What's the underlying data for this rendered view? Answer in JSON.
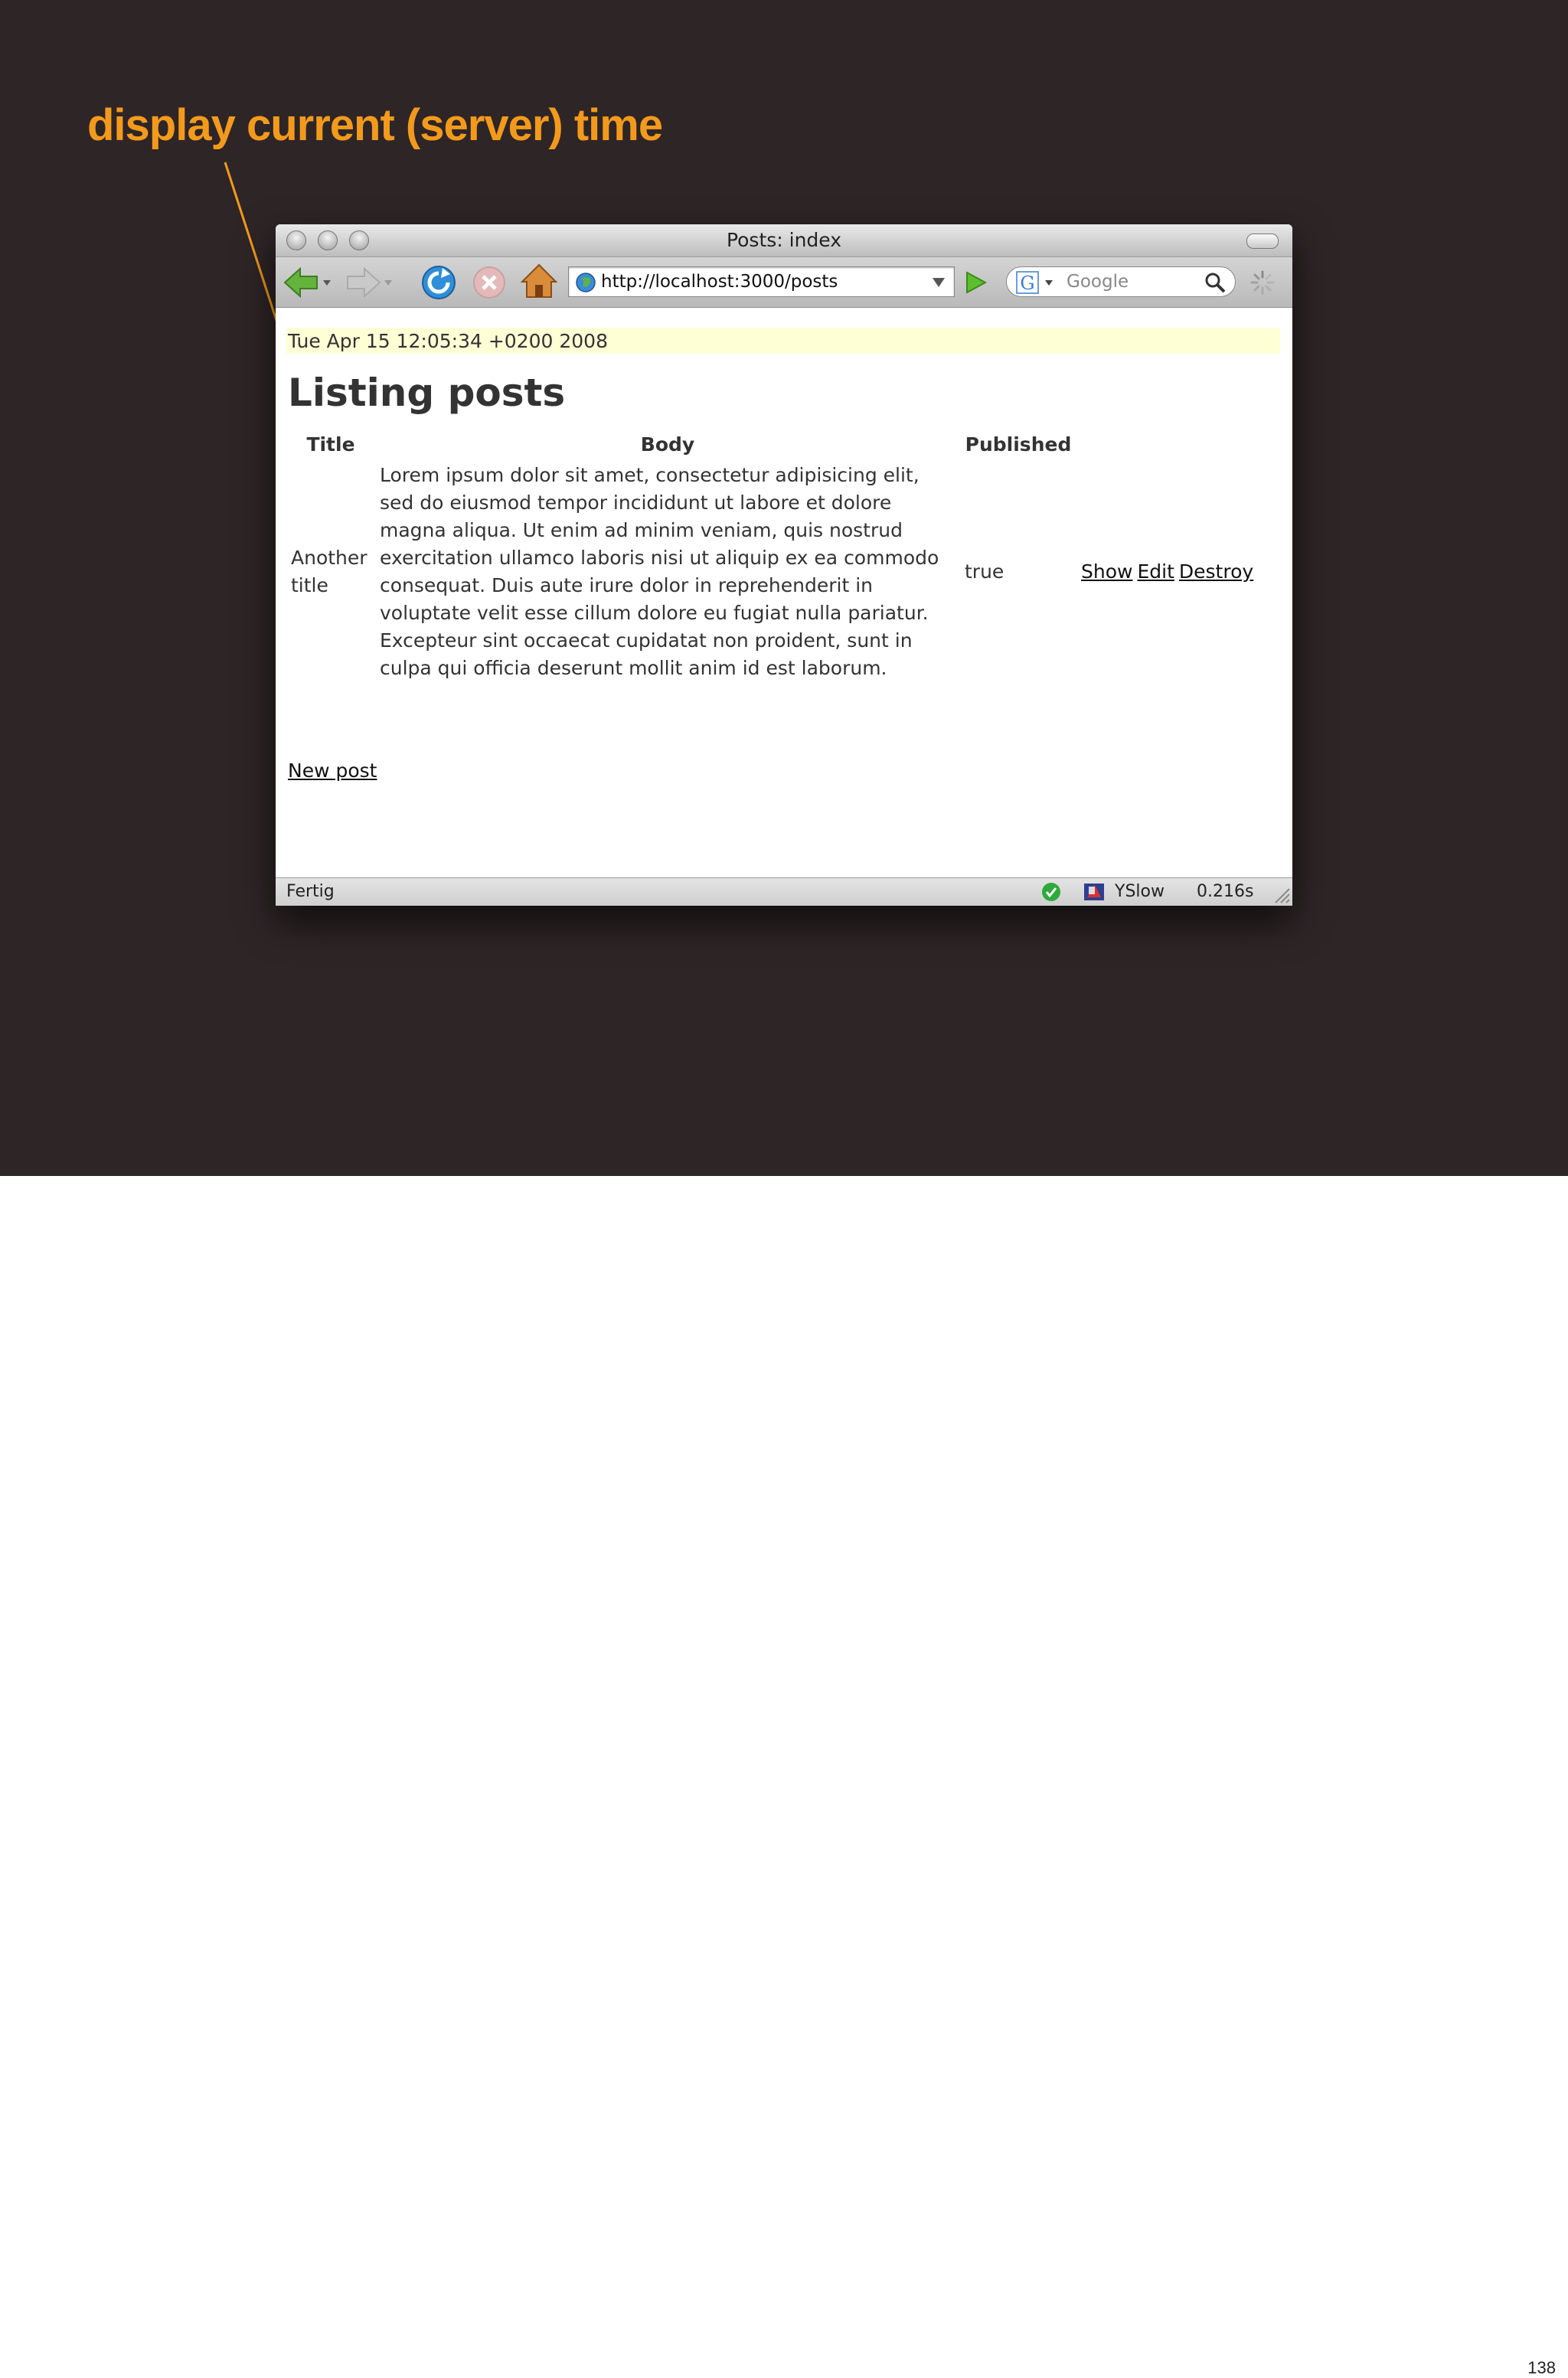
{
  "slide": {
    "caption": "display current (server) time",
    "page_number": "138",
    "accent_color": "#f39a1c",
    "background_color": "#2e2527"
  },
  "window": {
    "title": "Posts: index"
  },
  "toolbar": {
    "url": "http://localhost:3000/posts",
    "search_placeholder": "Google",
    "icons": [
      "back-arrow-icon",
      "forward-arrow-icon",
      "reload-icon",
      "stop-icon",
      "home-icon",
      "globe-icon",
      "go-arrow-icon",
      "google-g-icon",
      "search-icon",
      "spinner-icon"
    ]
  },
  "page": {
    "server_time": "Tue Apr 15 12:05:34 +0200 2008",
    "heading": "Listing posts",
    "table": {
      "headers": [
        "Title",
        "Body",
        "Published"
      ],
      "rows": [
        {
          "title": "Another title",
          "body": "Lorem ipsum dolor sit amet, consectetur adipisicing elit, sed do eiusmod tempor incididunt ut labore et dolore magna aliqua. Ut enim ad minim veniam, quis nostrud exercitation ullamco laboris nisi ut aliquip ex ea commodo consequat. Duis aute irure dolor in reprehenderit in voluptate velit esse cillum dolore eu fugiat nulla pariatur. Excepteur sint occaecat cupidatat non proident, sunt in culpa qui officia deserunt mollit anim id est laborum.",
          "published": "true",
          "actions": {
            "show": "Show",
            "edit": "Edit",
            "destroy": "Destroy"
          }
        }
      ]
    },
    "new_post_link": "New post"
  },
  "statusbar": {
    "status": "Fertig",
    "yslow_label": "YSlow",
    "load_time": "0.216s"
  }
}
